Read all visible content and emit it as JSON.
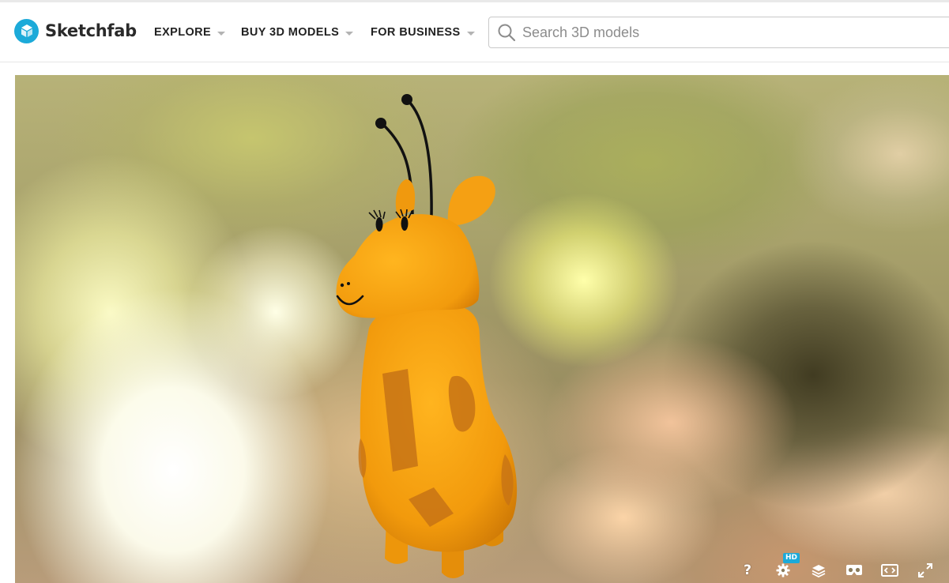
{
  "brand": {
    "name": "Sketchfab",
    "color": "#1caad9"
  },
  "nav": {
    "items": [
      {
        "label": "EXPLORE"
      },
      {
        "label": "BUY 3D MODELS"
      },
      {
        "label": "FOR BUSINESS"
      }
    ]
  },
  "search": {
    "placeholder": "Search 3D models",
    "value": ""
  },
  "viewer": {
    "controls": {
      "help_label": "?",
      "hd_badge": "HD"
    }
  }
}
